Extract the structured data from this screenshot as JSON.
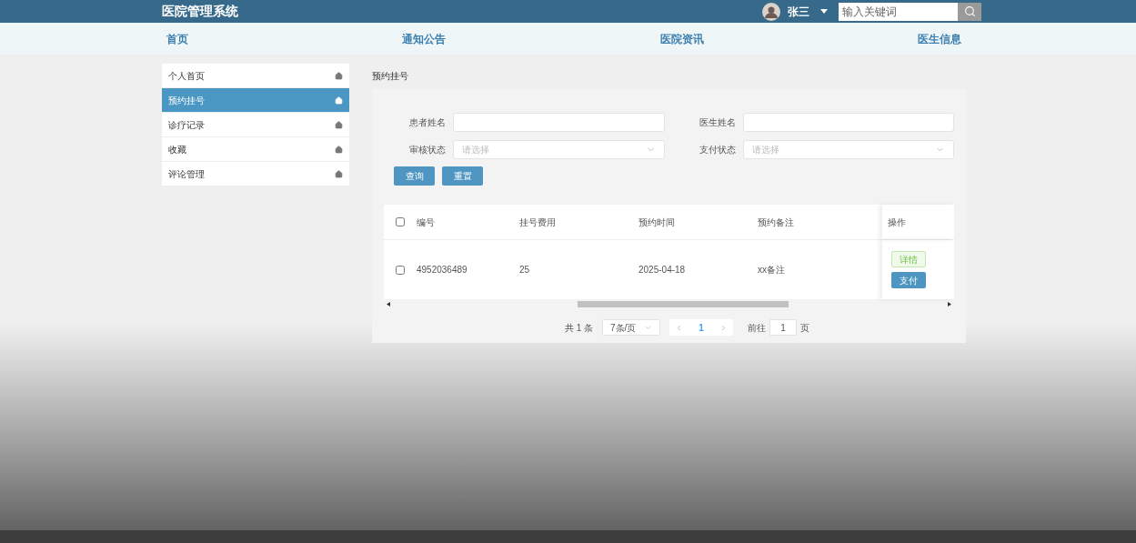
{
  "header": {
    "title": "医院管理系统",
    "user": "张三",
    "search": {
      "placeholder": "输入关键词"
    }
  },
  "nav": [
    {
      "label": "首页"
    },
    {
      "label": "通知公告"
    },
    {
      "label": "医院资讯"
    },
    {
      "label": "医生信息"
    }
  ],
  "sidebar": {
    "items": [
      {
        "label": "个人首页",
        "selected": false
      },
      {
        "label": "预约挂号",
        "selected": true
      },
      {
        "label": "诊疗记录",
        "selected": false
      },
      {
        "label": "收藏",
        "selected": false
      },
      {
        "label": "评论管理",
        "selected": false
      }
    ]
  },
  "page_title": "预约挂号",
  "filters": [
    {
      "label": "患者姓名",
      "kind": "text"
    },
    {
      "label": "医生姓名",
      "kind": "text"
    },
    {
      "label": "审核状态",
      "kind": "select",
      "placeholder": "请选择"
    },
    {
      "label": "支付状态",
      "kind": "select",
      "placeholder": "请选择"
    }
  ],
  "buttons": [
    "查询",
    "重置"
  ],
  "table": {
    "columns": [
      "编号",
      "挂号费用",
      "预约时间",
      "预约备注"
    ],
    "action_column": "操作",
    "rows": [
      {
        "checked": false,
        "cells": [
          "4952036489",
          "25",
          "2025-04-18",
          "xx备注"
        ],
        "actions": [
          "详情",
          "支付"
        ]
      }
    ],
    "all_checked": false
  },
  "pagination": {
    "total": "共 1 条",
    "page_size": "7条/页",
    "current": "1",
    "goto_label": "前往",
    "goto_value": "1",
    "page_suffix": "页"
  }
}
